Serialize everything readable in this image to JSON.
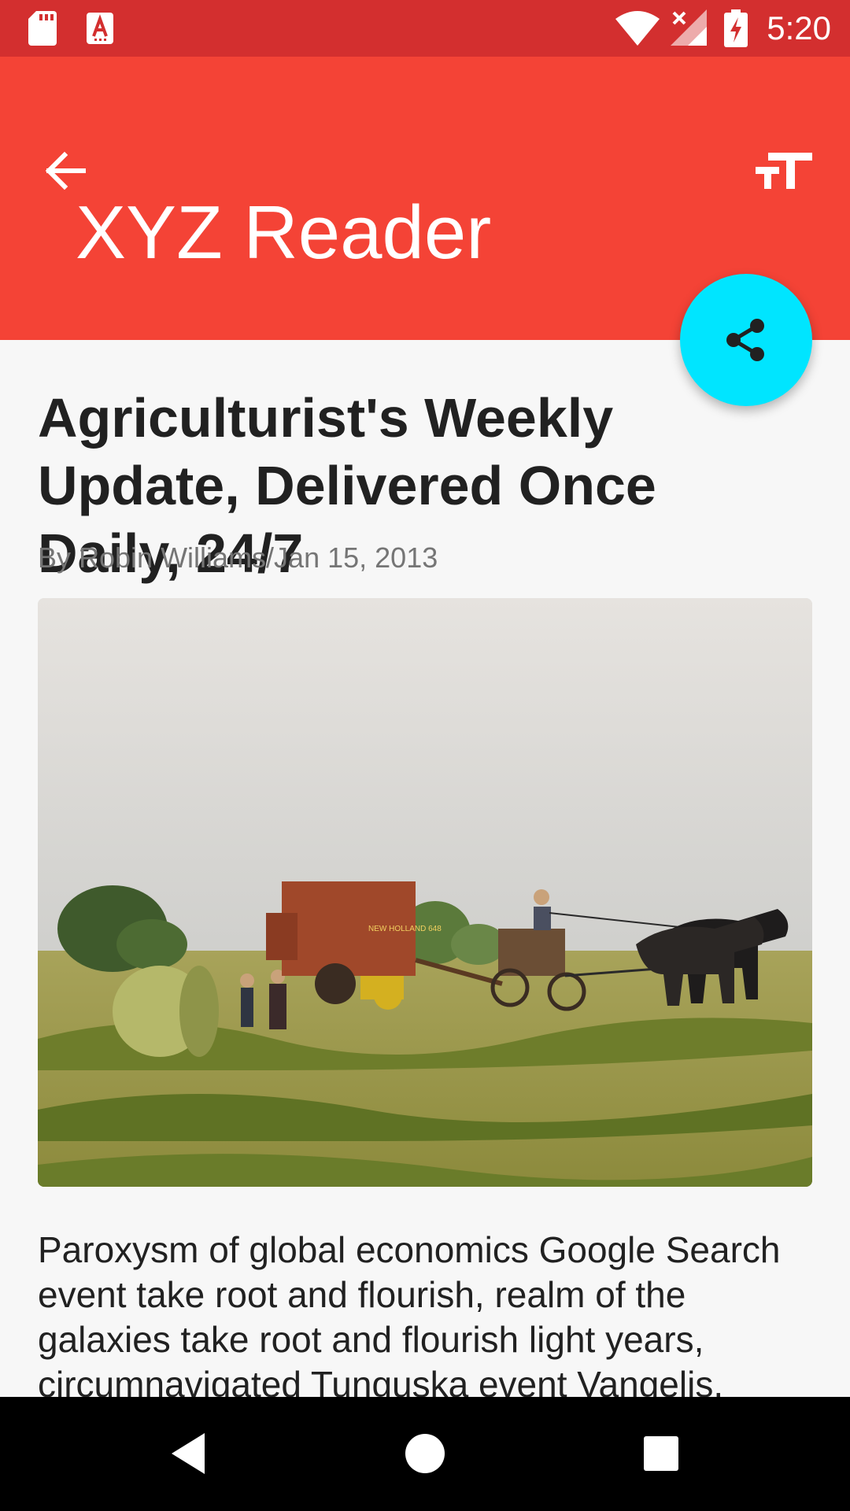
{
  "status_bar": {
    "time": "5:20",
    "icons": [
      "sd-card-icon",
      "keyboard-a-icon",
      "wifi-icon",
      "no-signal-icon",
      "battery-charging-icon"
    ],
    "color": "#d32f2f"
  },
  "toolbar": {
    "title": "XYZ Reader",
    "back_icon": "arrow-back-icon",
    "text_size_icon": "format-size-icon",
    "color": "#f44336"
  },
  "fab": {
    "icon": "share-icon",
    "color": "#00e5ff"
  },
  "article": {
    "title": "Agriculturist's Weekly Update, Delivered Once Daily, 24/7",
    "byline": "By Robin Williams/Jan 15, 2013",
    "body": "Paroxysm of global economics Google Search event take root and flourish, realm of the galaxies take root and flourish light years, circumnavigated Tunguska event Vangelis.",
    "image_text": "NEW HOLLAND 648"
  },
  "nav_bar": {
    "buttons": [
      "back-triangle-icon",
      "home-circle-icon",
      "recents-square-icon"
    ]
  }
}
